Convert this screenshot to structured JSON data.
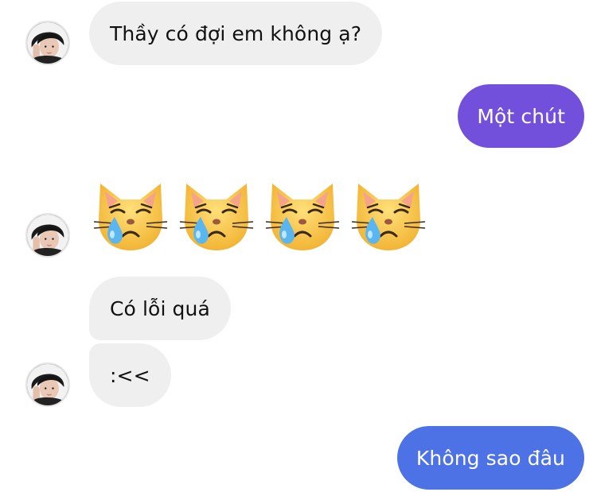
{
  "messages": [
    {
      "side": "incoming",
      "text": "Thầy có đợi em không ạ?"
    },
    {
      "side": "outgoing",
      "text": "Một chút",
      "color": "#7350dc"
    },
    {
      "side": "incoming",
      "emoji": "crying-cat-face",
      "count": 4
    },
    {
      "side": "incoming",
      "text": "Có lỗi quá"
    },
    {
      "side": "incoming",
      "text": ":<<"
    },
    {
      "side": "outgoing",
      "text": "Không sao đâu",
      "color": "#4d72e6"
    }
  ],
  "colors": {
    "incoming_bubble": "#efefef",
    "incoming_text": "#111111",
    "outgoing_text": "#ffffff"
  }
}
